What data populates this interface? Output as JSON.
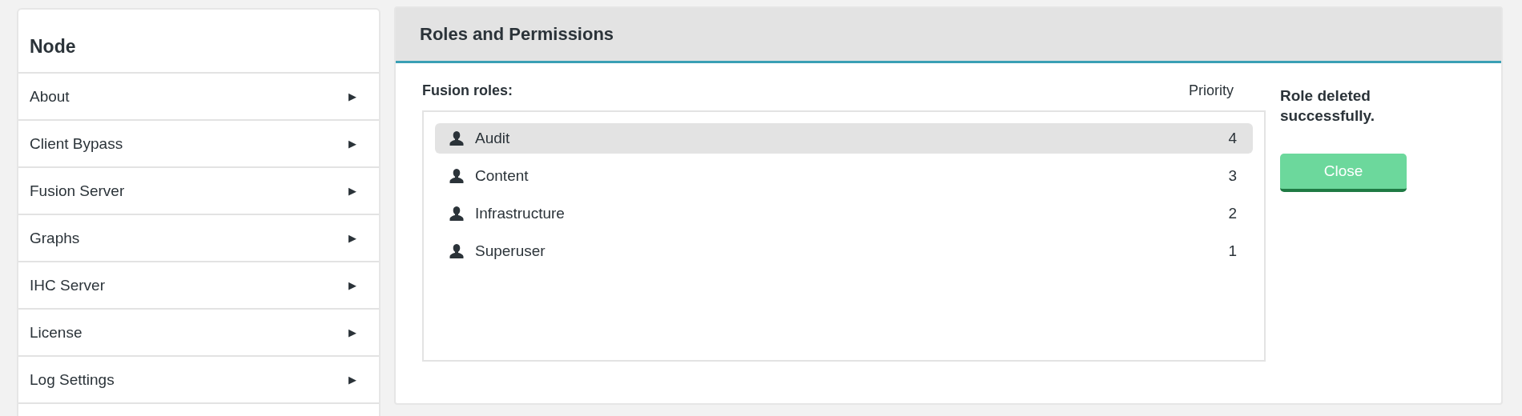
{
  "sidebar": {
    "title": "Node",
    "items": [
      {
        "label": "About",
        "arrow": "▶"
      },
      {
        "label": "Client Bypass",
        "arrow": "▶"
      },
      {
        "label": "Fusion Server",
        "arrow": "▶"
      },
      {
        "label": "Graphs",
        "arrow": "▶"
      },
      {
        "label": "IHC Server",
        "arrow": "▶"
      },
      {
        "label": "License",
        "arrow": "▶"
      },
      {
        "label": "Log Settings",
        "arrow": "▶"
      }
    ]
  },
  "panel": {
    "title": "Roles and Permissions",
    "list_label": "Fusion roles:",
    "priority_header": "Priority",
    "roles": [
      {
        "name": "Audit",
        "priority": "4",
        "selected": true
      },
      {
        "name": "Content",
        "priority": "3",
        "selected": false
      },
      {
        "name": "Infrastructure",
        "priority": "2",
        "selected": false
      },
      {
        "name": "Superuser",
        "priority": "1",
        "selected": false
      }
    ],
    "message": "Role deleted successfully.",
    "close_button": "Close"
  }
}
